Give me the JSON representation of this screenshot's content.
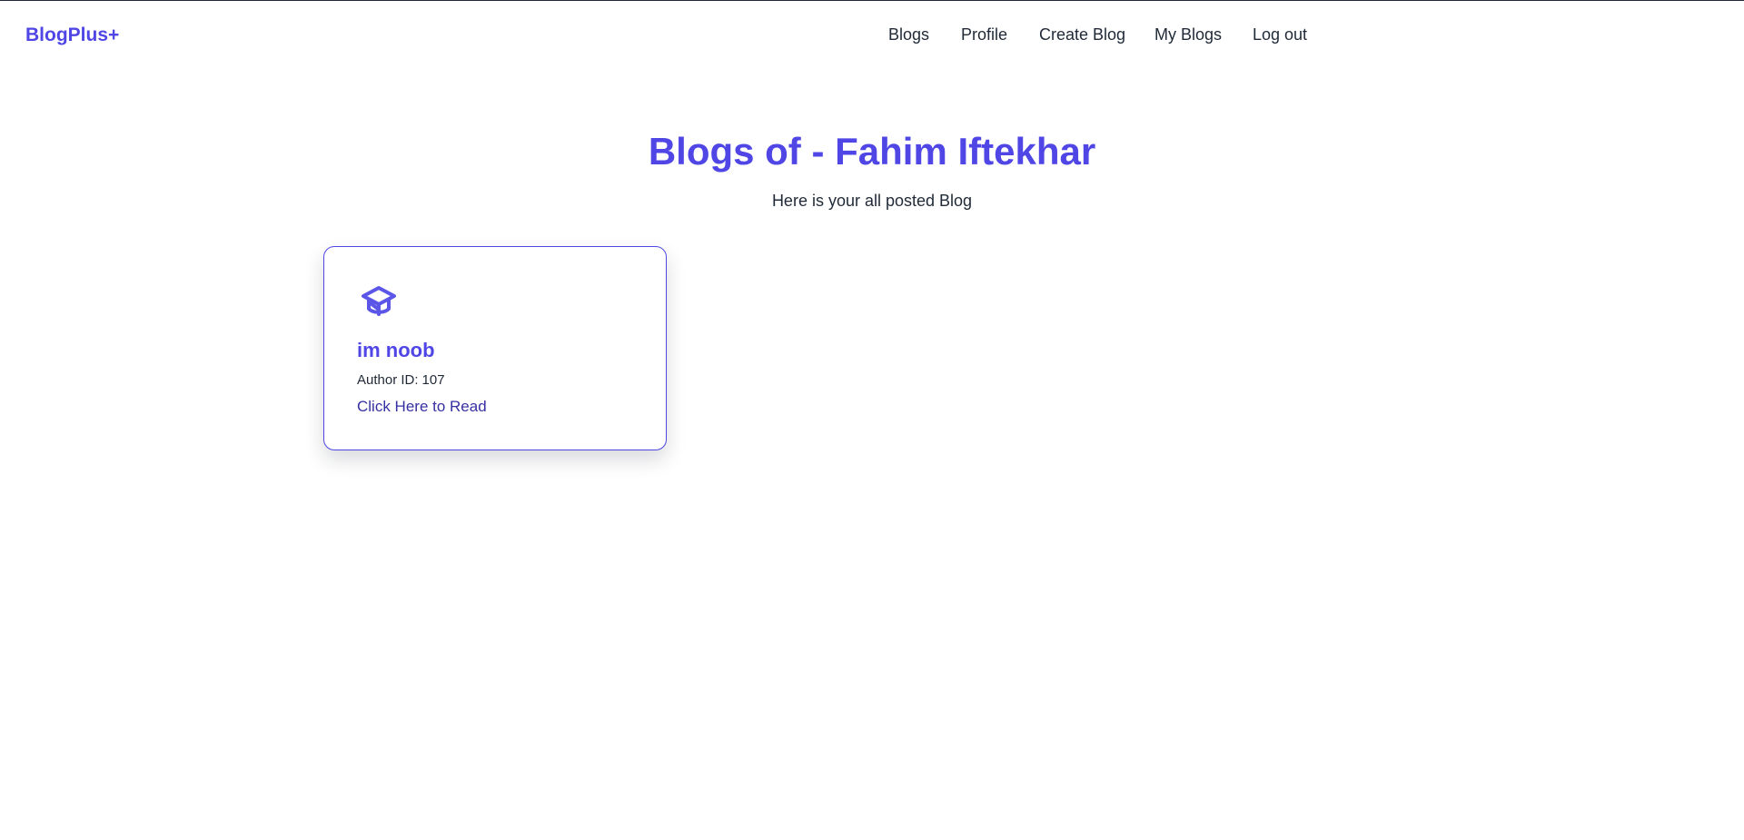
{
  "navbar": {
    "brand": "BlogPlus+",
    "links": [
      {
        "label": "Blogs"
      },
      {
        "label": "Profile"
      },
      {
        "label": "Create Blog"
      },
      {
        "label": "My Blogs"
      },
      {
        "label": "Log out"
      }
    ]
  },
  "page": {
    "title": "Blogs of - Fahim Iftekhar",
    "subtitle": "Here is your all posted Blog"
  },
  "blogs": [
    {
      "icon": "graduation-cap-icon",
      "title": "im noob",
      "author_label": "Author ID:",
      "author_id": "107",
      "link_label": "Click Here to Read"
    }
  ],
  "colors": {
    "accent": "#4f46e5",
    "link": "#3730a3",
    "text": "#1f2937"
  }
}
